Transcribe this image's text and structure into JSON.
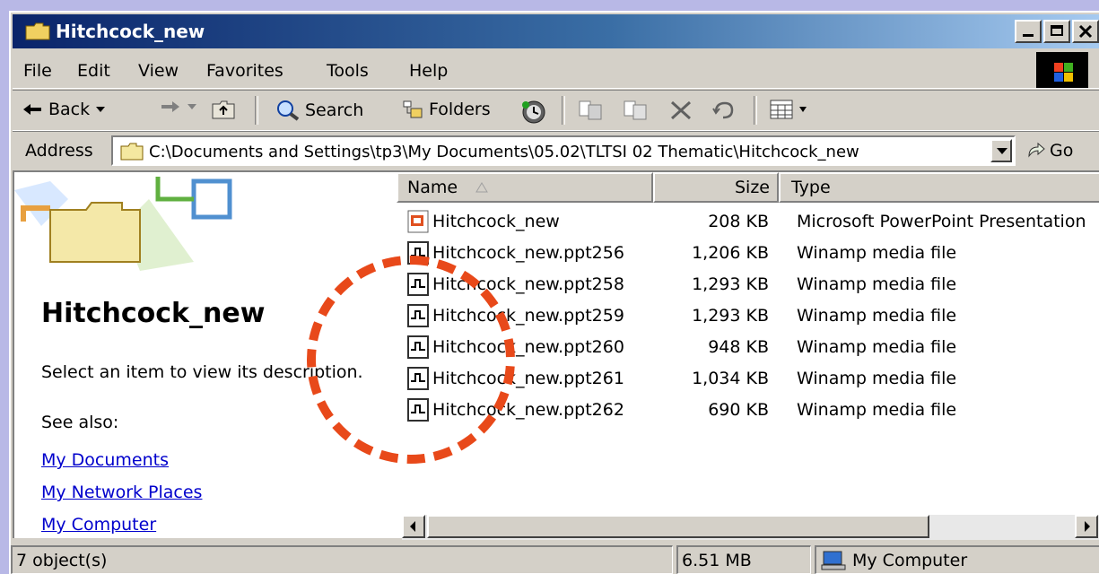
{
  "window": {
    "title": "Hitchcock_new"
  },
  "menu": {
    "items": [
      "File",
      "Edit",
      "View",
      "Favorites",
      "Tools",
      "Help"
    ]
  },
  "toolbar": {
    "back_label": "Back",
    "search_label": "Search",
    "folders_label": "Folders"
  },
  "address": {
    "label": "Address",
    "path": "C:\\Documents and Settings\\tp3\\My Documents\\05.02\\TLTSI 02 Thematic\\Hitchcock_new",
    "go_label": "Go"
  },
  "leftpane": {
    "title": "Hitchcock_new",
    "description": "Select an item to view its description.",
    "see_also": "See also:",
    "links": [
      "My Documents",
      "My Network Places",
      "My Computer"
    ]
  },
  "filelist": {
    "columns": {
      "name": "Name",
      "size": "Size",
      "type": "Type"
    },
    "rows": [
      {
        "name": "Hitchcock_new",
        "size": "208 KB",
        "type": "Microsoft PowerPoint Presentation",
        "icon": "powerpoint-icon"
      },
      {
        "name": "Hitchcock_new.ppt256",
        "size": "1,206 KB",
        "type": "Winamp media file",
        "icon": "winamp-file-icon"
      },
      {
        "name": "Hitchcock_new.ppt258",
        "size": "1,293 KB",
        "type": "Winamp media file",
        "icon": "winamp-file-icon"
      },
      {
        "name": "Hitchcock_new.ppt259",
        "size": "1,293 KB",
        "type": "Winamp media file",
        "icon": "winamp-file-icon"
      },
      {
        "name": "Hitchcock_new.ppt260",
        "size": "948 KB",
        "type": "Winamp media file",
        "icon": "winamp-file-icon"
      },
      {
        "name": "Hitchcock_new.ppt261",
        "size": "1,034 KB",
        "type": "Winamp media file",
        "icon": "winamp-file-icon"
      },
      {
        "name": "Hitchcock_new.ppt262",
        "size": "690 KB",
        "type": "Winamp media file",
        "icon": "winamp-file-icon"
      }
    ]
  },
  "status": {
    "objects": "7 object(s)",
    "size": "6.51 MB",
    "zone": "My Computer"
  },
  "colors": {
    "titlebar_start": "#0a246a",
    "titlebar_end": "#a6caf0",
    "annotation_circle": "#e8491a",
    "link": "#0000cc"
  }
}
